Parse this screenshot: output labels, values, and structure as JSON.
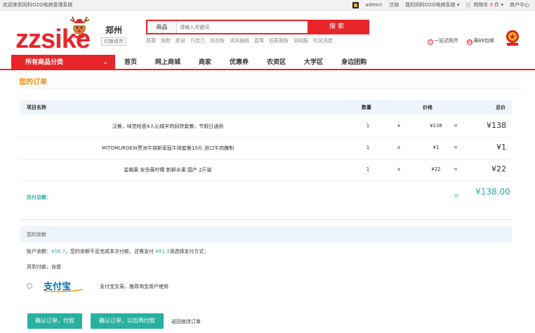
{
  "topbar": {
    "welcome": "欢迎来到同科O2O电商管理系统",
    "user": "admin!",
    "logout": "注销",
    "my_system": "我的同科O2O电商系统",
    "cart": "购物车",
    "cart_count": "0",
    "cart_unit": "件",
    "merchant_center": "商户中心"
  },
  "header": {
    "logo_text": "zzsike",
    "city": "郑州",
    "switch_city": "切换城市",
    "search_category": "商品",
    "search_placeholder": "请输入关键词",
    "search_button": "搜索",
    "hot_words": [
      "茼蒿",
      "拖鞋",
      "肥皂",
      "巧克力",
      "洗衣粉",
      "清风抽纸",
      "蓝莓",
      "低筋面粉",
      "羽绒服",
      "吹风洗脸"
    ],
    "promise_1": "一站式购齐",
    "promise_2": "满88包邮"
  },
  "nav": {
    "all_categories": "所有商品分类",
    "items": [
      "首页",
      "网上商城",
      "商家",
      "优惠券",
      "农资区",
      "大学区",
      "身边团购"
    ]
  },
  "order": {
    "title": "您的订单",
    "headers": {
      "name": "项目名称",
      "qty": "数量",
      "price": "价格",
      "total": "总价"
    },
    "rows": [
      {
        "name": "汉餐，味觉哈密4人沁城羊肉焖饼套餐，节假日通用",
        "qty": "1",
        "x": "x",
        "price": "¥138",
        "eq": "=",
        "total": "¥138"
      },
      {
        "name": "MITOMUROEW贾洲牛排新家庭牛排套餐10片 进口牛肉腌制",
        "qty": "1",
        "x": "x",
        "price": "¥1",
        "eq": "=",
        "total": "¥1"
      },
      {
        "name": "星期果 安岳黄柠檬 新鲜水果 国产 2斤装",
        "qty": "1",
        "x": "x",
        "price": "¥22",
        "eq": "=",
        "total": "¥22"
      }
    ],
    "payable_label": "应付总额：",
    "payable_eq": "=",
    "payable_value": "¥138.00"
  },
  "balance": {
    "section_title": "您的余额",
    "label": "账户余额：",
    "amount": "¥56.7",
    "middle": "，您的余额不足完成本次付款，还需支付",
    "need": "¥81.3",
    "suffix": "请选择支付方式：",
    "cod": "货到付款，自提"
  },
  "alipay": {
    "logo_text": "支付宝",
    "desc": "支付宝交易，推荐淘宝用户使用"
  },
  "actions": {
    "confirm_pay": "确认订单，付款",
    "confirm_later": "确认订单，以后再付款",
    "back": "返回修改订单"
  },
  "colors": {
    "brand_red": "#e8262a",
    "teal": "#2ab0a0",
    "orange_title": "#f08a00"
  }
}
